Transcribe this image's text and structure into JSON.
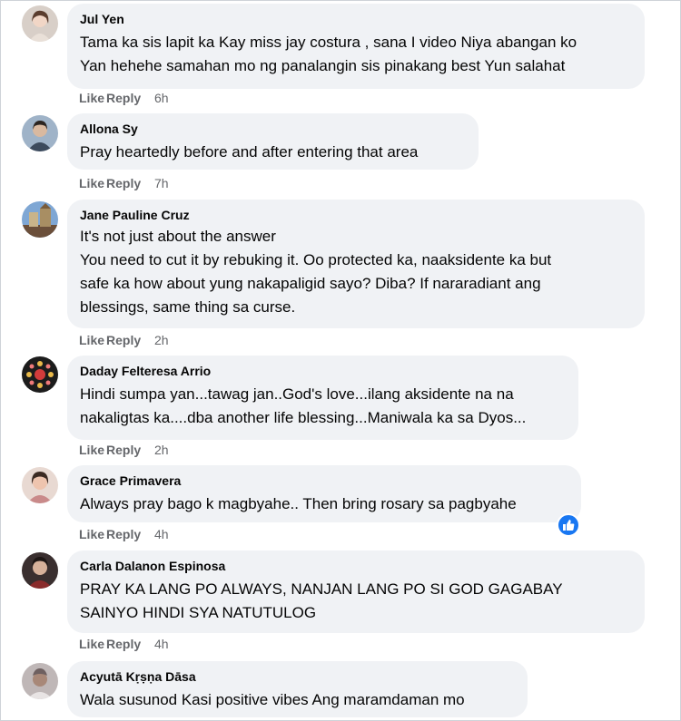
{
  "actions": {
    "like": "Like",
    "reply": "Reply"
  },
  "comments": [
    {
      "name": "Jul Yen",
      "lines": [
        "Tama ka sis lapit ka Kay miss jay costura , sana I video Niya abangan ko",
        "Yan hehehe samahan mo ng panalangin sis pinakang best Yun salahat"
      ],
      "time": "6h"
    },
    {
      "name": "Allona Sy",
      "lines": [
        "Pray heartedly before and after entering that area"
      ],
      "time": "7h"
    },
    {
      "name": "Jane Pauline Cruz",
      "lines": [
        "It's not just about the answer",
        "You need to cut it by rebuking it. Oo protected ka, naaksidente ka but",
        "safe ka how about yung nakapaligid sayo? Diba? If nararadiant ang",
        "blessings, same thing sa curse."
      ],
      "time": "2h"
    },
    {
      "name": "Daday Felteresa Arrio",
      "lines": [
        "Hindi sumpa yan...tawag jan..God's love...ilang aksidente na na",
        "nakaligtas ka....dba another life blessing...Maniwala ka sa Dyos..."
      ],
      "time": "2h"
    },
    {
      "name": "Grace Primavera",
      "lines": [
        "Always pray bago k magbyahe.. Then bring rosary sa pagbyahe"
      ],
      "time": "4h",
      "reaction": "like-icon"
    },
    {
      "name": "Carla Dalanon Espinosa",
      "lines": [
        "PRAY KA LANG PO ALWAYS, NANJAN LANG PO SI GOD GAGABAY",
        "SAINYO HINDI SYA NATUTULOG"
      ],
      "time": "4h"
    },
    {
      "name": "Acyutā Kṛṣṇa Dāsa",
      "lines": [
        "Wala susunod Kasi positive vibes Ang maramdaman mo"
      ]
    }
  ]
}
